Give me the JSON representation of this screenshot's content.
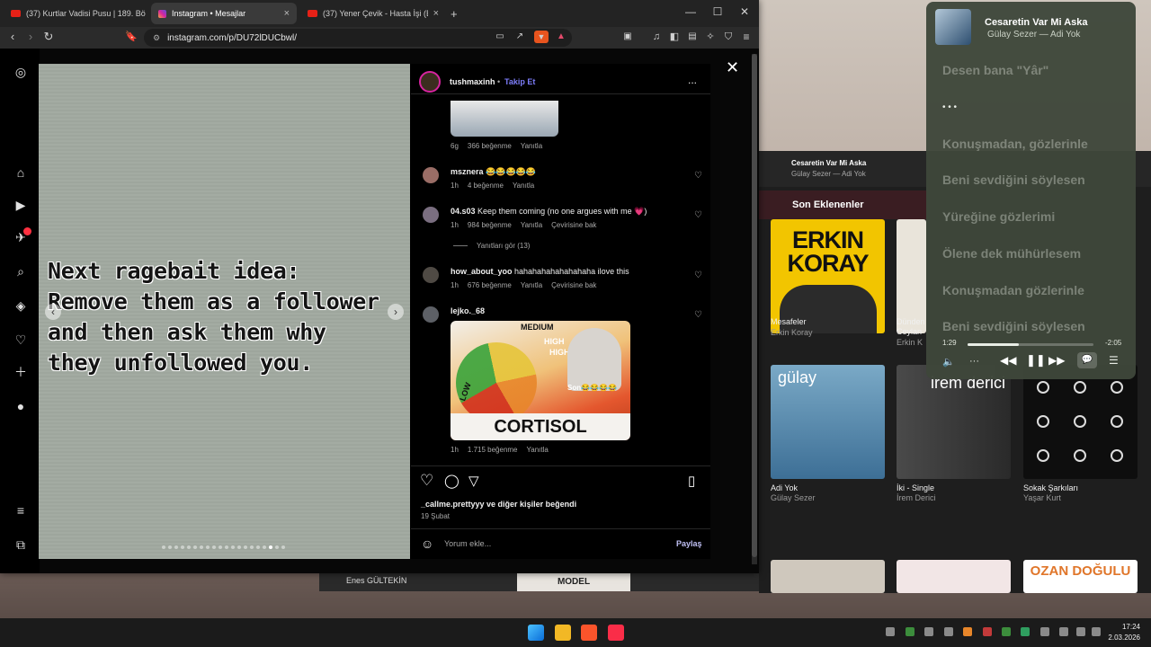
{
  "browser": {
    "tabs": [
      {
        "label": "(37) Kurtlar Vadisi Pusu | 189. Bölüm"
      },
      {
        "label": "Instagram • Mesajlar",
        "close": "×"
      },
      {
        "label": "(37) Yener Çevik - Hasta İşi (Ben Büdü",
        "close": "×"
      }
    ],
    "new_tab": "+",
    "url": "instagram.com/p/DU72lDUCbwl/"
  },
  "post": {
    "image_text": "Next ragebait idea:\nRemove them as a follower\nand then ask them why\nthey unfollowed you.",
    "author": "tushmaxinh",
    "follow": "Takip Et",
    "more": "...",
    "top_meta": {
      "time": "6g",
      "likes": "366 beğenme",
      "reply": "Yanıtla"
    },
    "comments": [
      {
        "user": "msznera",
        "text": "😂😂😂😂😂",
        "time": "1h",
        "likes": "4 beğenme",
        "reply": "Yanıtla",
        "translate": ""
      },
      {
        "user": "04.s03",
        "text": "Keep them coming (no one argues with me 💗)",
        "time": "1h",
        "likes": "984 beğenme",
        "reply": "Yanıtla",
        "translate": "Çevirisine bak"
      },
      {
        "user": "how_about_yoo",
        "text": "hahahahahahahahaha ilove this",
        "time": "1h",
        "likes": "676 beğenme",
        "reply": "Yanıtla",
        "translate": "Çevirisine bak"
      },
      {
        "user": "lejko._68",
        "text": "",
        "time": "1h",
        "likes": "1.715 beğenme",
        "reply": "Yanıtla",
        "translate": ""
      }
    ],
    "view_replies": "Yanıtları gör (13)",
    "meme": {
      "medium": "MEDIUM",
      "high": "HIGH",
      "low": "LOW",
      "son": "Son😂😂😂😂",
      "cortisol": "CORTISOL"
    },
    "liked_by": "_callme.prettyyy ve diğer kişiler beğendi",
    "date": "19 Şubat",
    "comment_placeholder": "Yorum ekle...",
    "share": "Paylaş"
  },
  "music": {
    "now_playing": {
      "title": "Cesaretin Var Mi Aska",
      "artist": "Gülay Sezer — Adi Yok"
    },
    "section": "Son Eklenenler",
    "albums": [
      {
        "title": "Mesafeler",
        "artist": "Erkin Koray",
        "cover": "ERKIN KORAY"
      },
      {
        "title": "Dünden Ceylan",
        "artist": "Erkin K",
        "cover": ""
      },
      {
        "title": "Adi Yok",
        "artist": "Gülay Sezer",
        "cover": "gülay"
      },
      {
        "title": "İki - Single",
        "artist": "İrem Derici",
        "cover": "irem derici"
      },
      {
        "title": "Sokak Şarkıları",
        "artist": "Yaşar Kurt",
        "cover": ""
      }
    ],
    "bottom_covers": [
      "",
      "",
      "OZAN DOĞULU"
    ],
    "mini_text": "Enes GÜLTEKİN",
    "model_label": "MODEL"
  },
  "lyrics": {
    "title": "Cesaretin Var Mi Aska",
    "artist": "Gülay Sezer — Adi Yok",
    "lines": [
      "Desen bana \"Yâr\"",
      "Konuşmadan, gözlerinle",
      "Beni sevdiğini söylesen",
      "Yüreğine gözlerimi",
      "Ölene dek mühürlesem",
      "Konuşmadan gözlerinle",
      "Beni sevdiğini söylesen"
    ],
    "elapsed": "1:29",
    "remaining": "-2:05",
    "progress": 0.41
  },
  "taskbar": {
    "time": "17:24",
    "date": "2.03.2026"
  },
  "colors": {
    "accent": "#7d7dfa",
    "ig_bg": "#000000",
    "lyrics_bg": "#3e473a",
    "music_pink": "#fa2d48"
  }
}
